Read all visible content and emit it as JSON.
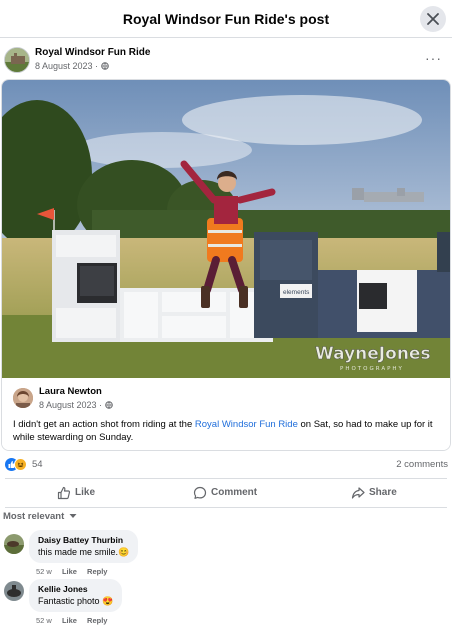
{
  "header": {
    "title": "Royal Windsor Fun Ride's post"
  },
  "post": {
    "page_name": "Royal Windsor Fun Ride",
    "date": "8 August 2023 ·",
    "privacy_icon": "globe-icon",
    "more_label": "···"
  },
  "shared": {
    "photo_watermark": "WayneJones",
    "photo_watermark_sub": "PHOTOGRAPHY",
    "kitchen_brand": "elements",
    "author": "Laura Newton",
    "date": "8 August 2023 ·",
    "text_before": "I didn't get an action shot from riding at the ",
    "text_link": "Royal Windsor Fun Ride",
    "text_after": " on Sat, so had to make up for it while stewarding on Sunday."
  },
  "reactions": {
    "count": "54",
    "types": [
      "like",
      "haha"
    ],
    "comments": "2 comments"
  },
  "actions": {
    "like": "Like",
    "comment": "Comment",
    "share": "Share"
  },
  "sort": {
    "label": "Most relevant"
  },
  "comments": [
    {
      "name": "Daisy Battey Thurbin",
      "text": "this made me smile.",
      "emoji": "😊",
      "time": "52 w",
      "like": "Like",
      "reply": "Reply"
    },
    {
      "name": "Kellie Jones",
      "text": "Fantastic photo",
      "emoji": "😍",
      "time": "52 w",
      "like": "Like",
      "reply": "Reply"
    }
  ],
  "colors": {
    "accent": "#1877f2",
    "link": "#216fdb",
    "muted": "#65676b",
    "bubble": "#f0f2f5"
  }
}
